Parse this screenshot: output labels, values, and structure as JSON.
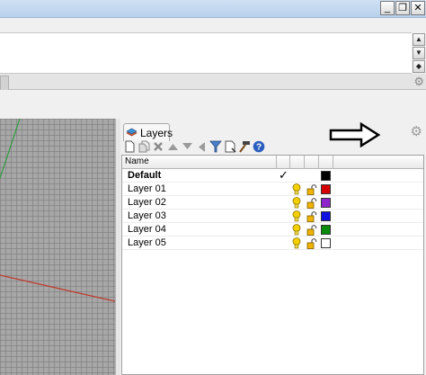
{
  "window": {
    "buttons": [
      {
        "name": "minimize",
        "glyph": "_"
      },
      {
        "name": "restore",
        "glyph": "❐"
      },
      {
        "name": "close",
        "glyph": "✕"
      }
    ]
  },
  "command_scroll": {
    "up": "▲",
    "down": "▼",
    "page": "◆"
  },
  "panel": {
    "tab_label": "Layers",
    "header": {
      "name_column": "Name"
    },
    "layers": [
      {
        "name": "Default",
        "current": true,
        "check": "✓",
        "color": "#000000"
      },
      {
        "name": "Layer 01",
        "current": false,
        "check": "",
        "color": "#d40000"
      },
      {
        "name": "Layer 02",
        "current": false,
        "check": "",
        "color": "#8e24c9"
      },
      {
        "name": "Layer 03",
        "current": false,
        "check": "",
        "color": "#1010e0"
      },
      {
        "name": "Layer 04",
        "current": false,
        "check": "",
        "color": "#0a8a0a"
      },
      {
        "name": "Layer 05",
        "current": false,
        "check": "",
        "color": "#ffffff"
      }
    ],
    "toolbar_icons": [
      "new-layer-icon",
      "new-sublayer-icon",
      "delete-icon",
      "move-up-icon",
      "move-down-icon",
      "move-left-icon",
      "filter-icon",
      "tools-icon",
      "hammer-icon",
      "help-icon"
    ]
  },
  "colors": {
    "viewport_bg": "#a7a7a7",
    "x_axis": "#c0392b",
    "y_axis": "#2e9c3f",
    "help_blue": "#2b5fbf",
    "bulb_yellow": "#f5d000",
    "lock_gold": "#f0b400"
  }
}
